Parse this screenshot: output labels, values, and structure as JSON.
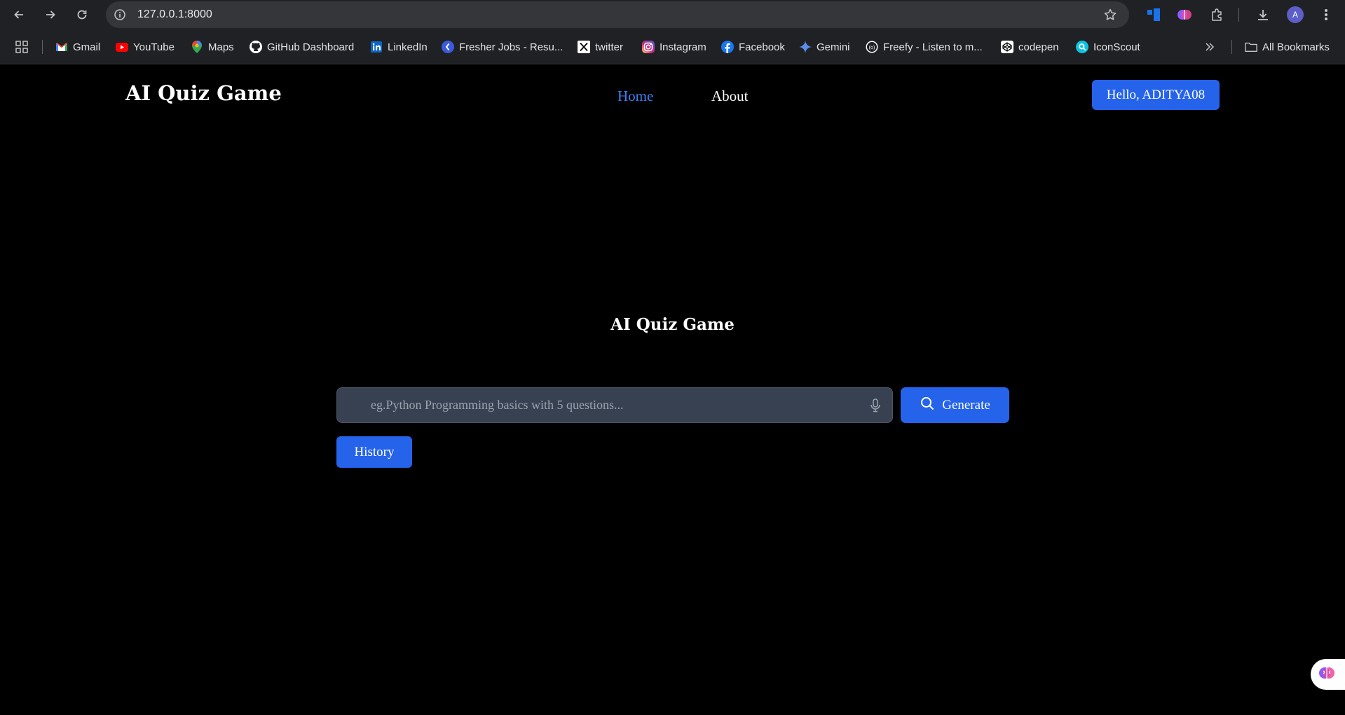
{
  "browser": {
    "url": "127.0.0.1:8000",
    "avatar_letter": "A",
    "bookmarks": [
      {
        "label": "Gmail",
        "icon": "gmail-icon"
      },
      {
        "label": "YouTube",
        "icon": "youtube-icon"
      },
      {
        "label": "Maps",
        "icon": "maps-icon"
      },
      {
        "label": "GitHub Dashboard",
        "icon": "github-icon"
      },
      {
        "label": "LinkedIn",
        "icon": "linkedin-icon"
      },
      {
        "label": "Fresher Jobs - Resu...",
        "icon": "fresher-jobs-icon"
      },
      {
        "label": "twitter",
        "icon": "x-icon"
      },
      {
        "label": "Instagram",
        "icon": "instagram-icon"
      },
      {
        "label": "Facebook",
        "icon": "facebook-icon"
      },
      {
        "label": "Gemini",
        "icon": "gemini-icon"
      },
      {
        "label": "Freefy - Listen to m...",
        "icon": "freefy-icon"
      },
      {
        "label": "codepen",
        "icon": "codepen-icon"
      },
      {
        "label": "IconScout",
        "icon": "iconscout-icon"
      }
    ],
    "all_bookmarks_label": "All Bookmarks"
  },
  "site": {
    "brand": "AI Quiz Game",
    "nav": {
      "home": "Home",
      "about": "About"
    },
    "user_button": "Hello,  ADITYA08"
  },
  "main": {
    "title": "AI Quiz Game",
    "search": {
      "placeholder": "eg.Python Programming basics with 5 questions...",
      "value": ""
    },
    "generate_label": "Generate",
    "history_label": "History"
  },
  "colors": {
    "accent": "#2563eb",
    "nav_active": "#3b82f6",
    "page_bg": "#000000",
    "input_bg": "#374151"
  }
}
